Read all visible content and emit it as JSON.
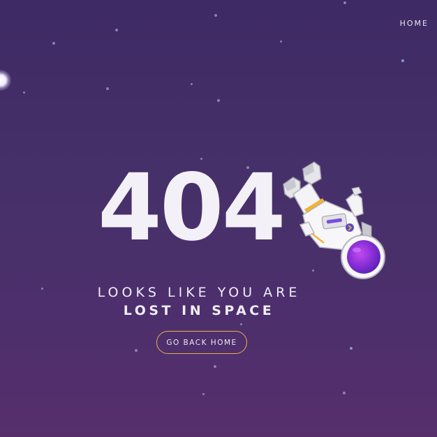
{
  "nav": {
    "home_label": "HOME"
  },
  "error": {
    "code": "404",
    "message_line1": "LOOKS LIKE YOU ARE",
    "message_line2": "LOST IN SPACE"
  },
  "actions": {
    "go_back_label": "GO BACK HOME"
  },
  "icons": {
    "astronaut": "astronaut-illustration",
    "moon": "moon-glow"
  },
  "colors": {
    "background_top": "#3e2a64",
    "background_bottom": "#562f6b",
    "button_border": "#e9b04a",
    "text": "#f3f1f7",
    "helmet_visor": "#8a2fd6"
  }
}
